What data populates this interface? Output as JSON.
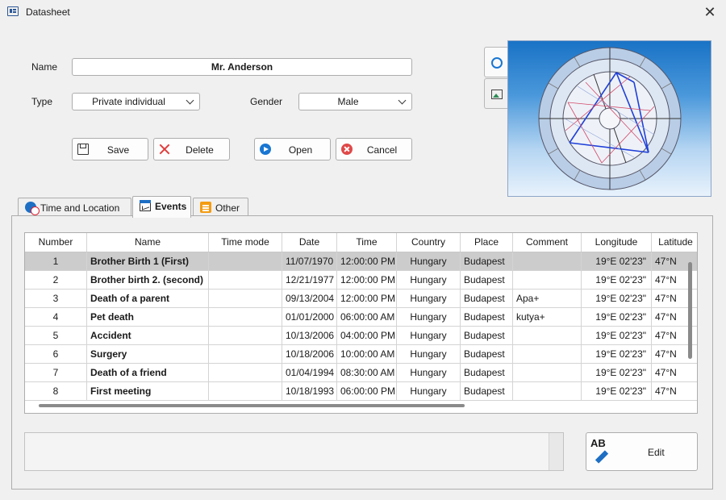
{
  "window": {
    "title": "Datasheet",
    "close_glyph": "✕"
  },
  "form": {
    "name_label": "Name",
    "name_value": "Mr. Anderson",
    "type_label": "Type",
    "type_value": "Private individual",
    "gender_label": "Gender",
    "gender_value": "Male"
  },
  "buttons": {
    "save": "Save",
    "delete": "Delete",
    "open": "Open",
    "cancel": "Cancel",
    "edit": "Edit",
    "edit_icon_text": "AB"
  },
  "tabs": [
    {
      "label": "Time and Location",
      "icon": "globe-clock-icon"
    },
    {
      "label": "Events",
      "icon": "events-chart-icon",
      "active": true
    },
    {
      "label": "Other",
      "icon": "list-icon"
    }
  ],
  "table": {
    "columns": [
      "Number",
      "Name",
      "Time mode",
      "Date",
      "Time",
      "Country",
      "Place",
      "Comment",
      "Longitude",
      "Latitude"
    ],
    "rows": [
      [
        "1",
        "Brother Birth 1 (First)",
        "",
        "11/07/1970",
        "12:00:00 PM",
        "Hungary",
        "Budapest",
        "",
        "19°E 02'23\"",
        "47°N"
      ],
      [
        "2",
        "Brother birth 2. (second)",
        "",
        "12/21/1977",
        "12:00:00 PM",
        "Hungary",
        "Budapest",
        "",
        "19°E 02'23\"",
        "47°N"
      ],
      [
        "3",
        "Death of a parent",
        "",
        "09/13/2004",
        "12:00:00 PM",
        "Hungary",
        "Budapest",
        "Apa+",
        "19°E 02'23\"",
        "47°N"
      ],
      [
        "4",
        "Pet death",
        "",
        "01/01/2000",
        "06:00:00 AM",
        "Hungary",
        "Budapest",
        "kutya+",
        "19°E 02'23\"",
        "47°N"
      ],
      [
        "5",
        "Accident",
        "",
        "10/13/2006",
        "04:00:00 PM",
        "Hungary",
        "Budapest",
        "",
        "19°E 02'23\"",
        "47°N"
      ],
      [
        "6",
        "Surgery",
        "",
        "10/18/2006",
        "10:00:00 AM",
        "Hungary",
        "Budapest",
        "",
        "19°E 02'23\"",
        "47°N"
      ],
      [
        "7",
        "Death of a friend",
        "",
        "01/04/1994",
        "08:30:00 AM",
        "Hungary",
        "Budapest",
        "",
        "19°E 02'23\"",
        "47°N"
      ],
      [
        "8",
        "First meeting",
        "",
        "10/18/1993",
        "06:00:00 PM",
        "Hungary",
        "Budapest",
        "",
        "19°E 02'23\"",
        "47°N"
      ]
    ],
    "selected_row": 0
  },
  "colors": {
    "accent": "#1976d2",
    "selected_row": "#cccccc",
    "delete_red": "#e03c3c"
  }
}
